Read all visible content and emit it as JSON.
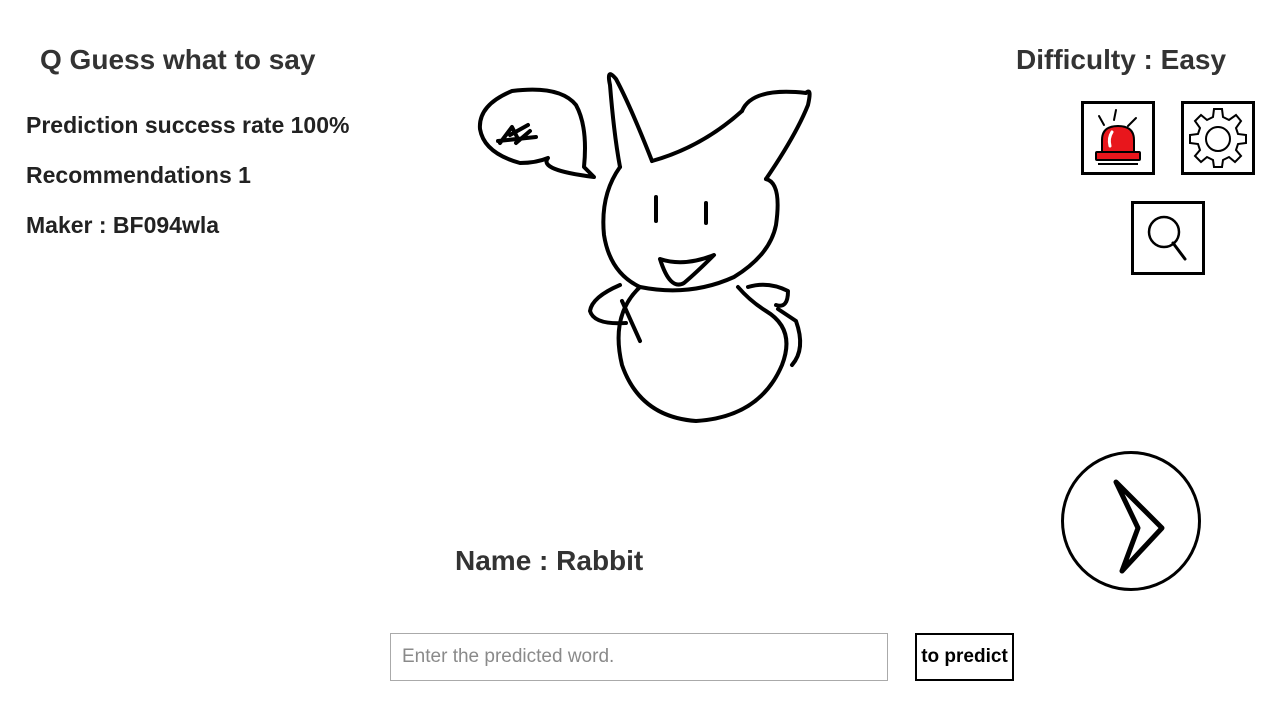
{
  "header": {
    "question_title": "Q Guess what to say",
    "difficulty": "Difficulty : Easy"
  },
  "info": {
    "prediction_rate": "Prediction success rate 100%",
    "recommendations": "Recommendations 1",
    "maker": "Maker : BF094wla"
  },
  "toolbar": {
    "icons": [
      "alarm-siren-icon",
      "gear-icon",
      "magnifier-icon",
      "play-arrow-icon"
    ],
    "alarm_color": "#e8161c"
  },
  "drawing": {
    "subject": "rabbit-doodle",
    "speech_bubble_text": "ㅎㅎ"
  },
  "answer": {
    "name": "Name : Rabbit"
  },
  "predict": {
    "placeholder": "Enter the predicted word.",
    "value": "",
    "button_label": "to predict"
  }
}
